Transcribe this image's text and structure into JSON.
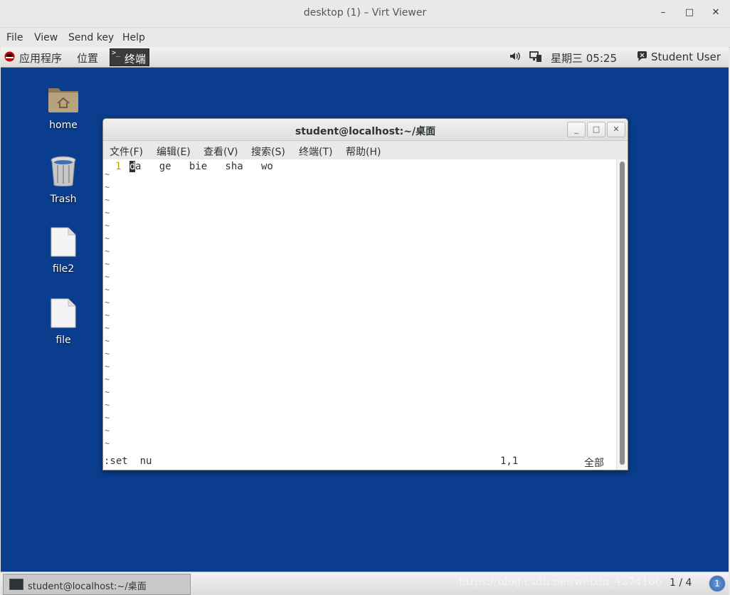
{
  "window": {
    "title": "desktop (1) – Virt Viewer",
    "min": "–",
    "max": "□",
    "close": "✕"
  },
  "menu": [
    "File",
    "View",
    "Send key",
    "Help"
  ],
  "panel": {
    "apps": "应用程序",
    "places": "位置",
    "terminal_task": "终端",
    "datetime": "星期三 05:25",
    "user": "Student User"
  },
  "desktop_icons": [
    "home",
    "Trash",
    "file2",
    "file"
  ],
  "terminal": {
    "title": "student@localhost:~/桌面",
    "menu": [
      "文件(F)",
      "编辑(E)",
      "查看(V)",
      "搜索(S)",
      "终端(T)",
      "帮助(H)"
    ],
    "line_number": "1",
    "cursor_char": "d",
    "line_rest": "a   ge   bie   sha   wo",
    "tilde": "~",
    "command": ":set  nu",
    "position": "1,1",
    "scroll": "全部"
  },
  "taskbar": {
    "item": "student@localhost:~/桌面",
    "workspace": "1 / 4",
    "workspace_badge": "1"
  },
  "watermark": "https://blog.csdn.net/weixin_4274186"
}
